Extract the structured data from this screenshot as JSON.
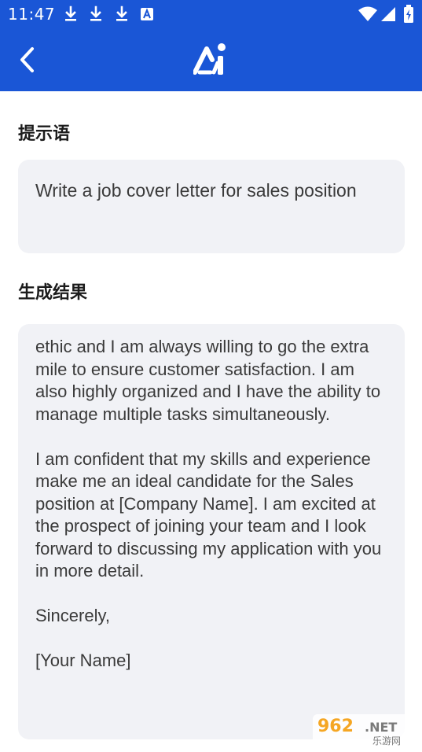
{
  "status_bar": {
    "time": "11:47",
    "icons": [
      "download-icon",
      "download-icon",
      "download-icon",
      "a-icon",
      "wifi-icon",
      "signal-icon",
      "battery-icon"
    ]
  },
  "app_bar": {
    "back_icon": "back-arrow-icon",
    "logo": "ai-logo",
    "color": "#1a56d6"
  },
  "prompt": {
    "title": "提示语",
    "text": "Write a job cover letter for sales position"
  },
  "result": {
    "title": "生成结果",
    "text": "ethic and I am always willing to go the extra mile to ensure customer satisfaction. I am also highly organized and I have the ability to manage multiple tasks simultaneously.\n\nI am confident that my skills and experience make me an ideal candidate for the Sales position at [Company Name]. I am excited at the prospect of joining your team and I look forward to discussing my application with you in more detail.\n\nSincerely,\n\n[Your Name]"
  },
  "watermark": {
    "brand": "962.NET",
    "subtitle": "乐游网"
  }
}
